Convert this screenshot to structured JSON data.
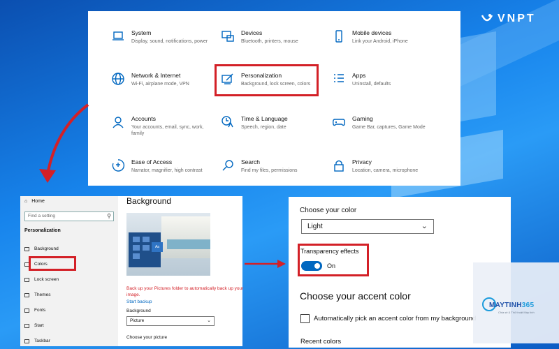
{
  "watermark": {
    "brand": "VNPT"
  },
  "settings_grid": [
    {
      "title": "System",
      "desc": "Display, sound, notifications, power",
      "icon": "laptop-icon"
    },
    {
      "title": "Devices",
      "desc": "Bluetooth, printers, mouse",
      "icon": "keyboard-icon"
    },
    {
      "title": "Mobile devices",
      "desc": "Link your Android, iPhone",
      "icon": "phone-icon"
    },
    {
      "title": "Network & Internet",
      "desc": "Wi-Fi, airplane mode, VPN",
      "icon": "globe-icon"
    },
    {
      "title": "Personalization",
      "desc": "Background, lock screen, colors",
      "icon": "paintbrush-icon"
    },
    {
      "title": "Apps",
      "desc": "Uninstall, defaults",
      "icon": "list-icon"
    },
    {
      "title": "Accounts",
      "desc": "Your accounts, email, sync, work, family",
      "icon": "person-icon"
    },
    {
      "title": "Time & Language",
      "desc": "Speech, region, date",
      "icon": "clock-language-icon"
    },
    {
      "title": "Gaming",
      "desc": "Game Bar, captures, Game Mode",
      "icon": "gamepad-icon"
    },
    {
      "title": "Ease of Access",
      "desc": "Narrator, magnifier, high contrast",
      "icon": "ease-of-access-icon"
    },
    {
      "title": "Search",
      "desc": "Find my files, permissions",
      "icon": "search-icon"
    },
    {
      "title": "Privacy",
      "desc": "Location, camera, microphone",
      "icon": "lock-icon"
    }
  ],
  "sidebar": {
    "home": "Home",
    "search_placeholder": "Find a setting",
    "section": "Personalization",
    "items": [
      "Background",
      "Colors",
      "Lock screen",
      "Themes",
      "Fonts",
      "Start",
      "Taskbar"
    ]
  },
  "background_page": {
    "title": "Background",
    "preview_tile": "Aa",
    "warning": "Back up your Pictures folder to automatically back up your image.",
    "link": "Start backup",
    "background_label": "Background",
    "background_value": "Picture",
    "choose_picture": "Choose your picture"
  },
  "colors_page": {
    "choose_color": "Choose your color",
    "color_value": "Light",
    "transparency_label": "Transparency effects",
    "transparency_state": "On",
    "transparency_on": true,
    "accent_heading": "Choose your accent color",
    "auto_accent": "Automatically pick an accent color from my background",
    "recent_colors": "Recent colors"
  },
  "card": {
    "brand_a": "MAYTINH",
    "brand_b": "365",
    "tagline": "Chia sẻ & Thủ thuật Máy tính"
  },
  "colors": {
    "accent": "#0067c0",
    "highlight": "#d32027"
  }
}
